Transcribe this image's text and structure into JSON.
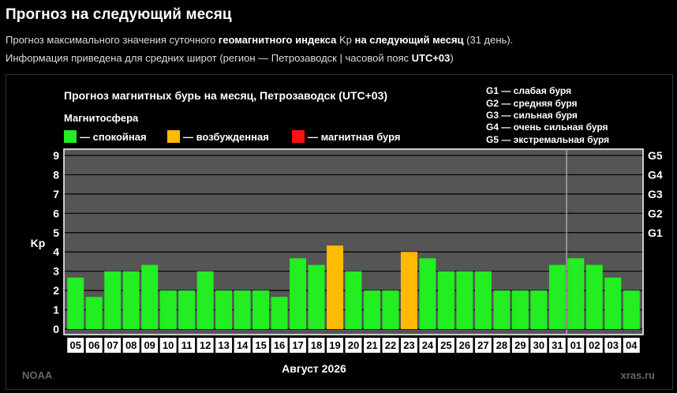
{
  "header": {
    "title": "Прогноз на следующий месяц",
    "desc1": {
      "t1": "Прогноз максимального значения суточного ",
      "b1": "геомагнитного индекса",
      "t2": " Kp ",
      "b2": "на следующий месяц",
      "t3": " (31 день)."
    },
    "desc2": {
      "t1": "Информация приведена для средних широт (регион — Петрозаводск | часовой пояс ",
      "b1": "UTC+03",
      "t2": ")"
    }
  },
  "colors": {
    "quiet": "#22ee22",
    "active": "#ffbb00",
    "storm": "#ff1111",
    "plot_bg": "#555555",
    "grid": "#000000",
    "frame": "#ffffff"
  },
  "chart_data": {
    "type": "bar",
    "title": "Прогноз магнитных бурь на месяц, Петрозаводск (UTC+03)",
    "legend_title": "Магнитосфера",
    "legend": [
      {
        "label": "— спокойная",
        "color": "#22ee22"
      },
      {
        "label": "— возбужденная",
        "color": "#ffbb00"
      },
      {
        "label": "— магнитная буря",
        "color": "#ff1111"
      }
    ],
    "g_legend": [
      "G1 — слабая буря",
      "G2 — средняя буря",
      "G3 — сильная буря",
      "G4 — очень сильная буря",
      "G5 — экстремальная буря"
    ],
    "ylabel": "Kp",
    "ylim": [
      0,
      9
    ],
    "yticks": [
      "0",
      "1",
      "2",
      "3",
      "4",
      "5",
      "6",
      "7",
      "8",
      "9"
    ],
    "right_ticks": [
      {
        "value": 5,
        "label": "G1"
      },
      {
        "value": 6,
        "label": "G2"
      },
      {
        "value": 7,
        "label": "G3"
      },
      {
        "value": 8,
        "label": "G4"
      },
      {
        "value": 9,
        "label": "G5"
      }
    ],
    "xlabel": "Август 2026",
    "categories": [
      "05",
      "06",
      "07",
      "08",
      "09",
      "10",
      "11",
      "12",
      "13",
      "14",
      "15",
      "16",
      "17",
      "18",
      "19",
      "20",
      "21",
      "22",
      "23",
      "24",
      "25",
      "26",
      "27",
      "28",
      "29",
      "30",
      "31",
      "01",
      "02",
      "03",
      "04"
    ],
    "values": [
      2.67,
      1.67,
      3,
      3,
      3.33,
      2,
      2,
      3,
      2,
      2,
      2,
      1.67,
      3.67,
      3.33,
      4.33,
      3,
      2,
      2,
      4,
      3.67,
      3,
      3,
      3,
      2,
      2,
      2,
      3.33,
      3.67,
      3.33,
      2.67,
      2
    ],
    "status": [
      "quiet",
      "quiet",
      "quiet",
      "quiet",
      "quiet",
      "quiet",
      "quiet",
      "quiet",
      "quiet",
      "quiet",
      "quiet",
      "quiet",
      "quiet",
      "quiet",
      "active",
      "quiet",
      "quiet",
      "quiet",
      "active",
      "quiet",
      "quiet",
      "quiet",
      "quiet",
      "quiet",
      "quiet",
      "quiet",
      "quiet",
      "quiet",
      "quiet",
      "quiet",
      "quiet"
    ],
    "month_divider_after": "31",
    "footer_left": "NOAA",
    "footer_right": "xras.ru"
  }
}
